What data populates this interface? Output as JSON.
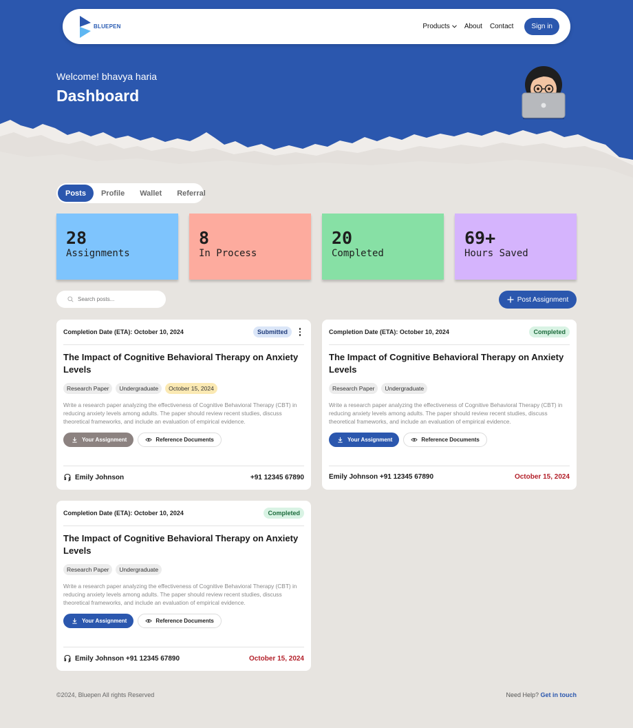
{
  "colors": {
    "hero_blue": "#2b57ae",
    "card_assignments": "#7ec4fd",
    "card_in_process": "#fdab9e",
    "card_completed": "#87e0a5",
    "card_hours": "#d5b4fd",
    "eta_red": "#b3202a",
    "button_gray": "#8c8280"
  },
  "nav": {
    "logo_text": "BLUEPEN",
    "links": [
      "Products",
      "About",
      "Contact"
    ],
    "signin": "Sign in"
  },
  "hero": {
    "welcome": "Welcome! bhavya haria",
    "title": "Dashboard"
  },
  "tabs": [
    "Posts",
    "Profile",
    "Wallet",
    "Referral"
  ],
  "stats": [
    {
      "value": "28",
      "label": "Assignments"
    },
    {
      "value": "8",
      "label": "In Process"
    },
    {
      "value": "20",
      "label": "Completed"
    },
    {
      "value": "69+",
      "label": "Hours Saved"
    }
  ],
  "search": {
    "placeholder": "Search posts..."
  },
  "post_button": "Post Assignment",
  "cards": [
    {
      "eta": "Completion Date (ETA): October 10, 2024",
      "status": "Submitted",
      "title": "The Impact of Cognitive Behavioral Therapy on Anxiety Levels",
      "tags": [
        "Research Paper",
        "Undergraduate",
        "October 15, 2024"
      ],
      "description": "Write a research paper analyzing the effectiveness of Cognitive Behavioral Therapy (CBT) in reducing anxiety levels among adults. The paper should review recent studies, discuss theoretical frameworks, and include an evaluation of empirical evidence.",
      "assign_label": "Your Assignment",
      "ref_label": "Reference Documents",
      "name": "Emily Johnson",
      "phone": "+91 12345 67890"
    },
    {
      "eta": "Completion Date (ETA): October 10, 2024",
      "status": "Completed",
      "title": "The Impact of Cognitive Behavioral Therapy on Anxiety Levels",
      "tags": [
        "Research Paper",
        "Undergraduate"
      ],
      "description": "Write a research paper analyzing the effectiveness of Cognitive Behavioral Therapy (CBT) in reducing anxiety levels among adults. The paper should review recent studies, discuss theoretical frameworks, and include an evaluation of empirical evidence.",
      "assign_label": "Your Assignment",
      "ref_label": "Reference Documents",
      "contact": "Emily Johnson +91 12345 67890",
      "date": "October 15, 2024"
    },
    {
      "eta": "Completion Date (ETA): October 10, 2024",
      "status": "Completed",
      "title": "The Impact of Cognitive Behavioral Therapy on Anxiety Levels",
      "tags": [
        "Research Paper",
        "Undergraduate"
      ],
      "description": "Write a research paper analyzing the effectiveness of Cognitive Behavioral Therapy (CBT) in reducing anxiety levels among adults. The paper should review recent studies, discuss theoretical frameworks, and include an evaluation of empirical evidence.",
      "assign_label": "Your Assignment",
      "ref_label": "Reference Documents",
      "contact": "Emily Johnson +91 12345 67890",
      "date": "October 15, 2024"
    }
  ],
  "footer": {
    "copyright": "©2024, Bluepen All rights Reserved",
    "help": "Need Help?",
    "help_link": "Get in touch"
  }
}
